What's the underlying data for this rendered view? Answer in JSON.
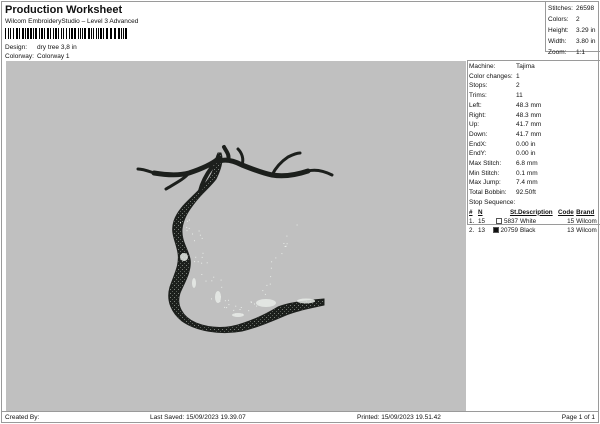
{
  "header": {
    "title": "Production Worksheet",
    "subtitle": "Wilcom EmbroideryStudio – Level 3 Advanced",
    "design_label": "Design:",
    "design_value": "dry tree 3,8 in",
    "colorway_label": "Colorway:",
    "colorway_value": "Colorway 1"
  },
  "stats": [
    {
      "label": "Stitches:",
      "value": "26598"
    },
    {
      "label": "Colors:",
      "value": "2"
    },
    {
      "label": "Height:",
      "value": "3.29 in"
    },
    {
      "label": "Width:",
      "value": "3.80 in"
    },
    {
      "label": "Zoom:",
      "value": "1:1"
    }
  ],
  "info": [
    {
      "label": "Machine:",
      "value": "Tajima"
    },
    {
      "label": "Color changes:",
      "value": "1"
    },
    {
      "label": "Stops:",
      "value": "2"
    },
    {
      "label": "Trims:",
      "value": "11"
    },
    {
      "label": "Left:",
      "value": "48.3 mm"
    },
    {
      "label": "Right:",
      "value": "48.3 mm"
    },
    {
      "label": "Up:",
      "value": "41.7 mm"
    },
    {
      "label": "Down:",
      "value": "41.7 mm"
    },
    {
      "label": "EndX:",
      "value": "0.00 in"
    },
    {
      "label": "EndY:",
      "value": "0.00 in"
    },
    {
      "label": "Max Stitch:",
      "value": "6.8 mm"
    },
    {
      "label": "Min Stitch:",
      "value": "0.1 mm"
    },
    {
      "label": "Max Jump:",
      "value": "7.4 mm"
    },
    {
      "label": "Total Bobbin:",
      "value": "92.50ft"
    }
  ],
  "sequence": {
    "heading": "Stop Sequence:",
    "columns": [
      "#",
      "N",
      "St.",
      "Description",
      "Code",
      "Brand"
    ],
    "rows": [
      {
        "num": "1.",
        "n": "15",
        "st": "5837",
        "desc": "White",
        "code": "15",
        "brand": "Wilcom",
        "color": "#ffffff"
      },
      {
        "num": "2.",
        "n": "13",
        "st": "20759",
        "desc": "Black",
        "code": "13",
        "brand": "Wilcom",
        "color": "#111111"
      }
    ]
  },
  "colors": {
    "canvas": "#c0c0c0",
    "tree": "#1c1f1c",
    "highlight": "#e8ece8"
  },
  "footer": {
    "created": "Created By:",
    "last_saved": "Last Saved: 15/09/2023 19.39.07",
    "printed": "Printed: 15/09/2023 19.51.42",
    "page": "Page 1 of 1"
  }
}
